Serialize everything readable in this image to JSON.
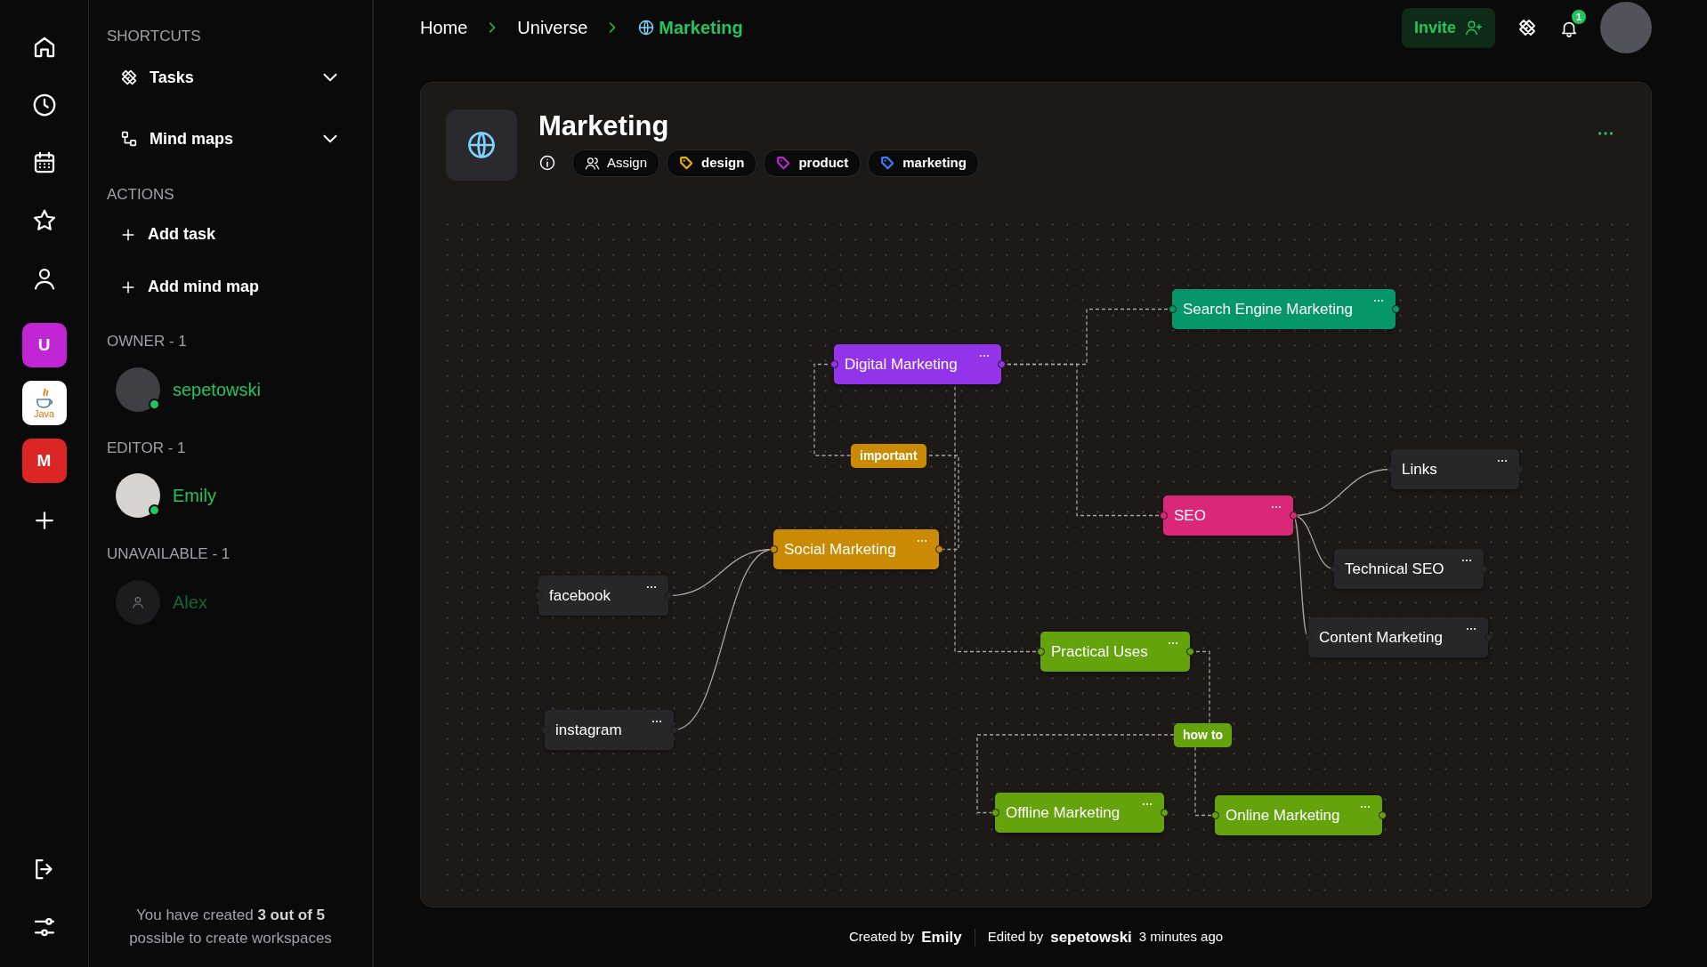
{
  "rail": {
    "workspaces": [
      {
        "kind": "letter",
        "label": "U",
        "color": "#c026d3"
      },
      {
        "kind": "logo",
        "label": "Java",
        "color": "#ffffff"
      },
      {
        "kind": "letter",
        "label": "M",
        "color": "#dc2626"
      }
    ]
  },
  "sidebar": {
    "shortcuts": {
      "title": "SHORTCUTS",
      "items": [
        {
          "label": "Tasks",
          "expanded": false
        },
        {
          "label": "Mind maps",
          "expanded": false
        }
      ]
    },
    "actions": {
      "title": "ACTIONS",
      "items": [
        "Add task",
        "Add mind map"
      ]
    },
    "member_groups": [
      {
        "title": "OWNER - 1",
        "members": [
          {
            "name": "sepetowski",
            "online": true
          }
        ]
      },
      {
        "title": "EDITOR - 1",
        "members": [
          {
            "name": "Emily",
            "online": true
          }
        ]
      },
      {
        "title": "UNAVAILABLE - 1",
        "members": [
          {
            "name": "Alex",
            "online": false
          }
        ]
      }
    ],
    "note": "You have created **3 out of 5** possible to create workspaces"
  },
  "breadcrumbs": [
    {
      "label": "Home",
      "current": false
    },
    {
      "label": "Universe",
      "current": false
    },
    {
      "label": "Marketing",
      "current": true
    }
  ],
  "header": {
    "invite": "Invite",
    "notifications": "1"
  },
  "workspace": {
    "title": "Marketing",
    "assign": "Assign",
    "tags": [
      {
        "label": "design",
        "color": "#eab308"
      },
      {
        "label": "product",
        "color": "#c026d3"
      },
      {
        "label": "marketing",
        "color": "#3b82f6"
      }
    ],
    "mind_map": {
      "nodes": [
        {
          "label": "Digital Marketing",
          "color": "#9333ea",
          "children": [
            {
              "label": "Search Engine Marketing",
              "color": "#059669",
              "dashed": true
            },
            {
              "label": "SEO",
              "color": "#db2777",
              "dashed": true,
              "children": [
                {
                  "label": "Links",
                  "color": "#27272a",
                  "dashed": false
                },
                {
                  "label": "Technical SEO",
                  "color": "#27272a",
                  "dashed": false
                },
                {
                  "label": "Content Marketing",
                  "color": "#27272a",
                  "dashed": false
                }
              ]
            },
            {
              "label": "Practical Uses",
              "color": "#65a30d",
              "dashed": true,
              "branch_label": "how to",
              "children": [
                {
                  "label": "Offline Marketing",
                  "color": "#65a30d",
                  "dashed": true
                },
                {
                  "label": "Online Marketing",
                  "color": "#65a30d",
                  "dashed": true
                }
              ]
            },
            {
              "label": "Social Marketing",
              "color": "#ca8a04",
              "dashed": true,
              "edge_label": "important",
              "children": [
                {
                  "label": "facebook",
                  "color": "#27272a",
                  "dashed": false
                },
                {
                  "label": "instagram",
                  "color": "#27272a",
                  "dashed": false
                }
              ]
            }
          ]
        }
      ]
    }
  },
  "footer": {
    "created_label": "Created by",
    "created_by": "Emily",
    "edited_label": "Edited by",
    "edited_by": "sepetowski",
    "time": "3 minutes ago"
  }
}
